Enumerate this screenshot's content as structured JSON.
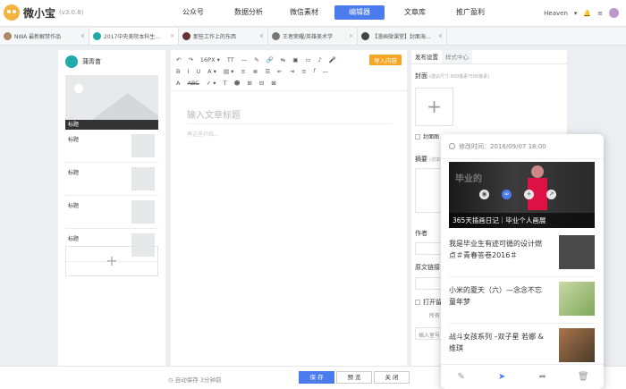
{
  "app": {
    "name": "微小宝",
    "version": "(v3.0.8)"
  },
  "nav": [
    "公众号",
    "数据分析",
    "微信素材",
    "编辑器",
    "文章库",
    "推广盈利"
  ],
  "user": {
    "name": "Heaven",
    "bell": "bell-icon",
    "menu": "menu-icon"
  },
  "doc_tabs": [
    {
      "label": "NWA 最新解禁作品"
    },
    {
      "label": "2017中央美院本科生..."
    },
    {
      "label": "那些工作上的东西"
    },
    {
      "label": "王者荣耀/英雄美术学"
    },
    {
      "label": "【漫画微课堂】封面海..."
    }
  ],
  "left": {
    "account_name": "蒲青苗",
    "cover_label": "标题",
    "items": [
      "标题",
      "标题",
      "标题",
      "标题"
    ],
    "add_label": "+"
  },
  "editor": {
    "toolbar_row1": [
      "↶",
      "↷",
      "16PX ▾",
      "TT",
      "—",
      "✎",
      "🔗",
      "⇆",
      "▣",
      "▭",
      "♪",
      "🎤"
    ],
    "toolbar_row2": [
      "B",
      "I",
      "U",
      "A ▾",
      "▤ ▾",
      "≡",
      "≣",
      "☰",
      "⇤",
      "⇥",
      "≡",
      "𝑓",
      "—"
    ],
    "toolbar_row3": [
      "A",
      "ABC",
      "✓ ▾",
      "T",
      "☻",
      "⊞",
      "⊟",
      "⊠"
    ],
    "import_label": "导入内容",
    "title_placeholder": "输入文章标题",
    "author_placeholder": "再这里开始..."
  },
  "settings": {
    "tabs": [
      "发布设置",
      "样式中心"
    ],
    "cover_label": "封面",
    "cover_hint": "(建议尺寸:900像素*500像素)",
    "body_cover": "封面图",
    "summary_label": "摘要",
    "summary_hint": "(选填)",
    "author_label": "作者",
    "link_label": "原文链接",
    "open_label": "打开留",
    "all_label": "所有",
    "insert_label": "插入室号"
  },
  "bottom": {
    "autosave": "自动保存 3分钟前",
    "save": "保 存",
    "preview": "预 览",
    "close": "关 闭"
  },
  "popup": {
    "time": "修改时间：2016/09/07 18:00",
    "hero_caption": "365天插画日记｜毕业个人画展",
    "hero_text": "毕业的",
    "items": [
      {
        "title": "我是毕业生有迹可循的设计燃点＃青春答卷2016＃",
        "thumb": "#4a4a4a"
      },
      {
        "title": "小米的夏天（六）—念念不忘童年梦",
        "thumb": "#9db86e"
      },
      {
        "title": "战斗女孩系列 –双子星 若娜 & 维琪",
        "thumb": "#7a5a3a"
      }
    ],
    "footer_icons": [
      "edit-icon",
      "send-icon",
      "share-icon",
      "delete-icon"
    ]
  }
}
